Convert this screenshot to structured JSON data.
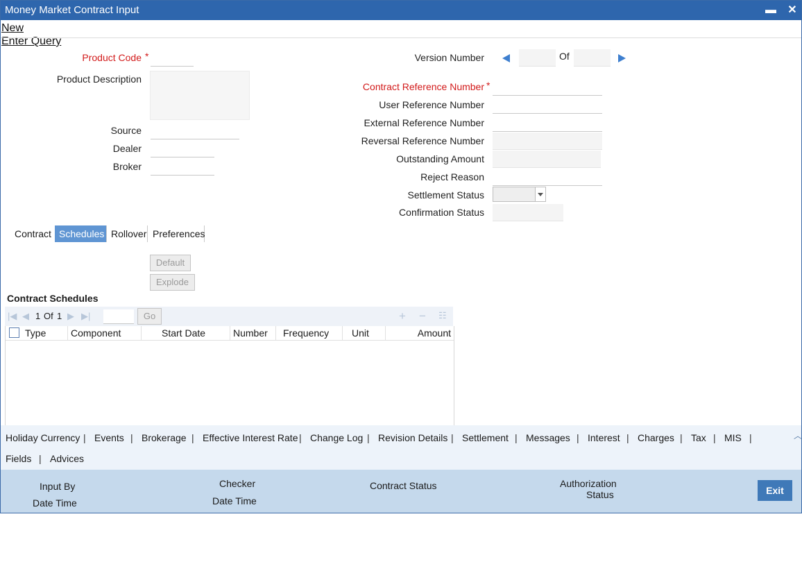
{
  "window": {
    "title": "Money Market Contract Input",
    "minimize": "▬",
    "close": "✕"
  },
  "menu": {
    "new": "New",
    "enter_query": "Enter Query"
  },
  "left_fields": {
    "product_code": "Product Code",
    "product_description": "Product Description",
    "source": "Source",
    "dealer": "Dealer",
    "broker": "Broker"
  },
  "right_fields": {
    "version_number": "Version Number",
    "of": "Of",
    "contract_reference_number": "Contract Reference Number",
    "user_reference_number": "User Reference Number",
    "external_reference_number": "External Reference Number",
    "reversal_reference_number": "Reversal Reference Number",
    "outstanding_amount": "Outstanding Amount",
    "reject_reason": "Reject Reason",
    "settlement_status": "Settlement Status",
    "confirmation_status": "Confirmation Status"
  },
  "required_mark": "*",
  "tabs": [
    "Contract",
    "Schedules",
    "Rollover",
    "Preferences"
  ],
  "active_tab": "Schedules",
  "actions": {
    "default": "Default",
    "explode": "Explode"
  },
  "schedules": {
    "title": "Contract Schedules",
    "pager": {
      "current": "1",
      "of": "Of",
      "total": "1",
      "go": "Go"
    },
    "columns": [
      "Type",
      "Component",
      "Start Date",
      "Number",
      "Frequency",
      "Unit",
      "Amount"
    ]
  },
  "sublinks_row1": [
    "Holiday Currency",
    "Events",
    "Brokerage",
    "Effective Interest Rate",
    "Change Log",
    "Revision Details",
    "Settlement",
    "Messages",
    "Interest",
    "Charges",
    "Tax",
    "MIS"
  ],
  "sublinks_row2": [
    "Fields",
    "Advices"
  ],
  "separator": "|",
  "footer": {
    "input_by": "Input By",
    "date_time_1": "Date Time",
    "checker": "Checker",
    "date_time_2": "Date Time",
    "contract_status": "Contract Status",
    "authorization": "Authorization",
    "status": "Status",
    "exit": "Exit"
  },
  "colors": {
    "titlebar": "#2e66ad",
    "accent": "#5f95d3",
    "required": "#d21a1a",
    "footer": "#c5d9ec"
  }
}
